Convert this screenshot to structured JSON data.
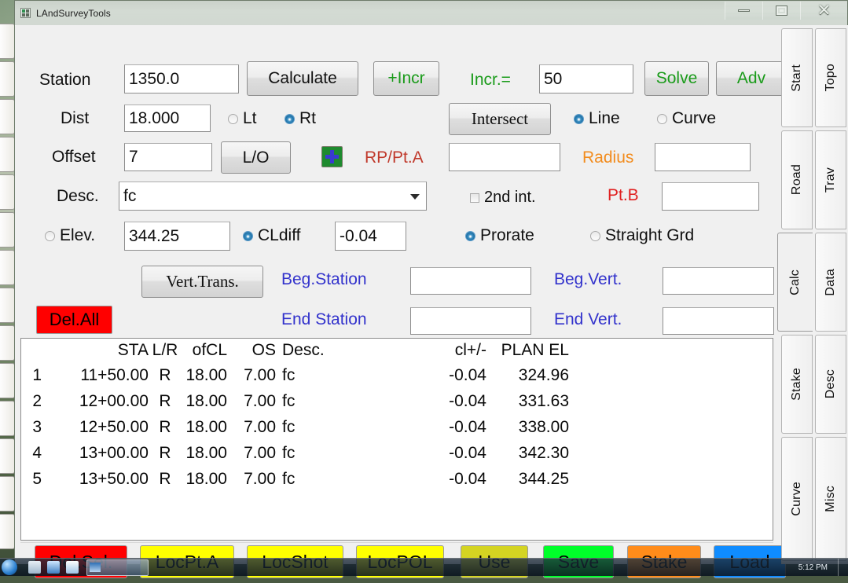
{
  "window": {
    "title": "LAndSurveyTools",
    "icon": "app-icon",
    "controls": {
      "minimize": "minimize-icon",
      "maximize": "maximize-icon",
      "close": "close-icon"
    }
  },
  "taskbar": {
    "clock": "5:12 PM"
  },
  "form": {
    "station": {
      "label": "Station",
      "value": "1350.0"
    },
    "calculate_label": "Calculate",
    "incr_button_label": "+Incr",
    "incr_label": "Incr.=",
    "incr_value": "50",
    "solve_label": "Solve",
    "adv_label": "Adv",
    "dist": {
      "label": "Dist",
      "value": "18.000"
    },
    "side": {
      "left_label": "Lt",
      "right_label": "Rt",
      "selected": "Rt"
    },
    "intersect_label": "Intersect",
    "geometry": {
      "line_label": "Line",
      "curve_label": "Curve",
      "selected": "Line"
    },
    "offset": {
      "label": "Offset",
      "value": "7"
    },
    "lo_label": "L/O",
    "add_point_icon": "plus-icon",
    "rp_pta": {
      "label": "RP/Pt.A",
      "value": ""
    },
    "radius": {
      "label": "Radius",
      "value": ""
    },
    "desc": {
      "label": "Desc.",
      "value": "fc"
    },
    "second_int": {
      "label": "2nd int.",
      "checked": false
    },
    "pt_b": {
      "label": "Pt.B",
      "value": ""
    },
    "elev": {
      "label": "Elev.",
      "value": "344.25",
      "selected": false
    },
    "cldiff": {
      "label": "CLdiff",
      "value": "-0.04",
      "selected": true
    },
    "grade": {
      "prorate_label": "Prorate",
      "straight_label": "Straight Grd",
      "selected": "Prorate"
    },
    "vert_trans_label": "Vert.Trans.",
    "beg_station": {
      "label": "Beg.Station",
      "value": ""
    },
    "end_station": {
      "label": "End Station",
      "value": ""
    },
    "beg_vert": {
      "label": "Beg.Vert.",
      "value": ""
    },
    "end_vert": {
      "label": "End Vert.",
      "value": ""
    },
    "del_all_label": "Del.All"
  },
  "list": {
    "headers": {
      "idx": "",
      "sta": "STA",
      "lr": "L/R",
      "ofcl": "ofCL",
      "os": "OS",
      "desc": "Desc.",
      "cl": "cl+/-",
      "plan": "PLAN EL"
    },
    "rows": [
      {
        "idx": "1",
        "sta": "11+50.00",
        "lr": "R",
        "ofcl": "18.00",
        "os": "7.00",
        "desc": "fc",
        "cl": "-0.04",
        "plan": "324.96"
      },
      {
        "idx": "2",
        "sta": "12+00.00",
        "lr": "R",
        "ofcl": "18.00",
        "os": "7.00",
        "desc": "fc",
        "cl": "-0.04",
        "plan": "331.63"
      },
      {
        "idx": "3",
        "sta": "12+50.00",
        "lr": "R",
        "ofcl": "18.00",
        "os": "7.00",
        "desc": "fc",
        "cl": "-0.04",
        "plan": "338.00"
      },
      {
        "idx": "4",
        "sta": "13+00.00",
        "lr": "R",
        "ofcl": "18.00",
        "os": "7.00",
        "desc": "fc",
        "cl": "-0.04",
        "plan": "342.30"
      },
      {
        "idx": "5",
        "sta": "13+50.00",
        "lr": "R",
        "ofcl": "18.00",
        "os": "7.00",
        "desc": "fc",
        "cl": "-0.04",
        "plan": "344.25"
      }
    ]
  },
  "actions": [
    {
      "label": "Del.Sel.",
      "color": "#ff0000"
    },
    {
      "label": "LocPt.A",
      "color": "#ffff00"
    },
    {
      "label": "LocShot",
      "color": "#ffff00"
    },
    {
      "label": "LocPOL",
      "color": "#ffff00"
    },
    {
      "label": "Use",
      "color": "#d4d422"
    },
    {
      "label": "Save",
      "color": "#00ff2a"
    },
    {
      "label": "Stake",
      "color": "#ff8c1a"
    },
    {
      "label": "Load",
      "color": "#0f8cff"
    }
  ],
  "tabs": {
    "inner": [
      "Start",
      "Road",
      "Calc",
      "Stake",
      "Curve"
    ],
    "outer": [
      "Topo",
      "Trav",
      "Data",
      "Desc",
      "Misc"
    ],
    "selected": "Calc"
  },
  "colors": {
    "green": "#1a9b1a",
    "orange": "#f28c1e",
    "red": "#e02020",
    "dark_red": "#c0392b",
    "blue": "#3333cc",
    "del_all_bg": "#ff0000"
  }
}
